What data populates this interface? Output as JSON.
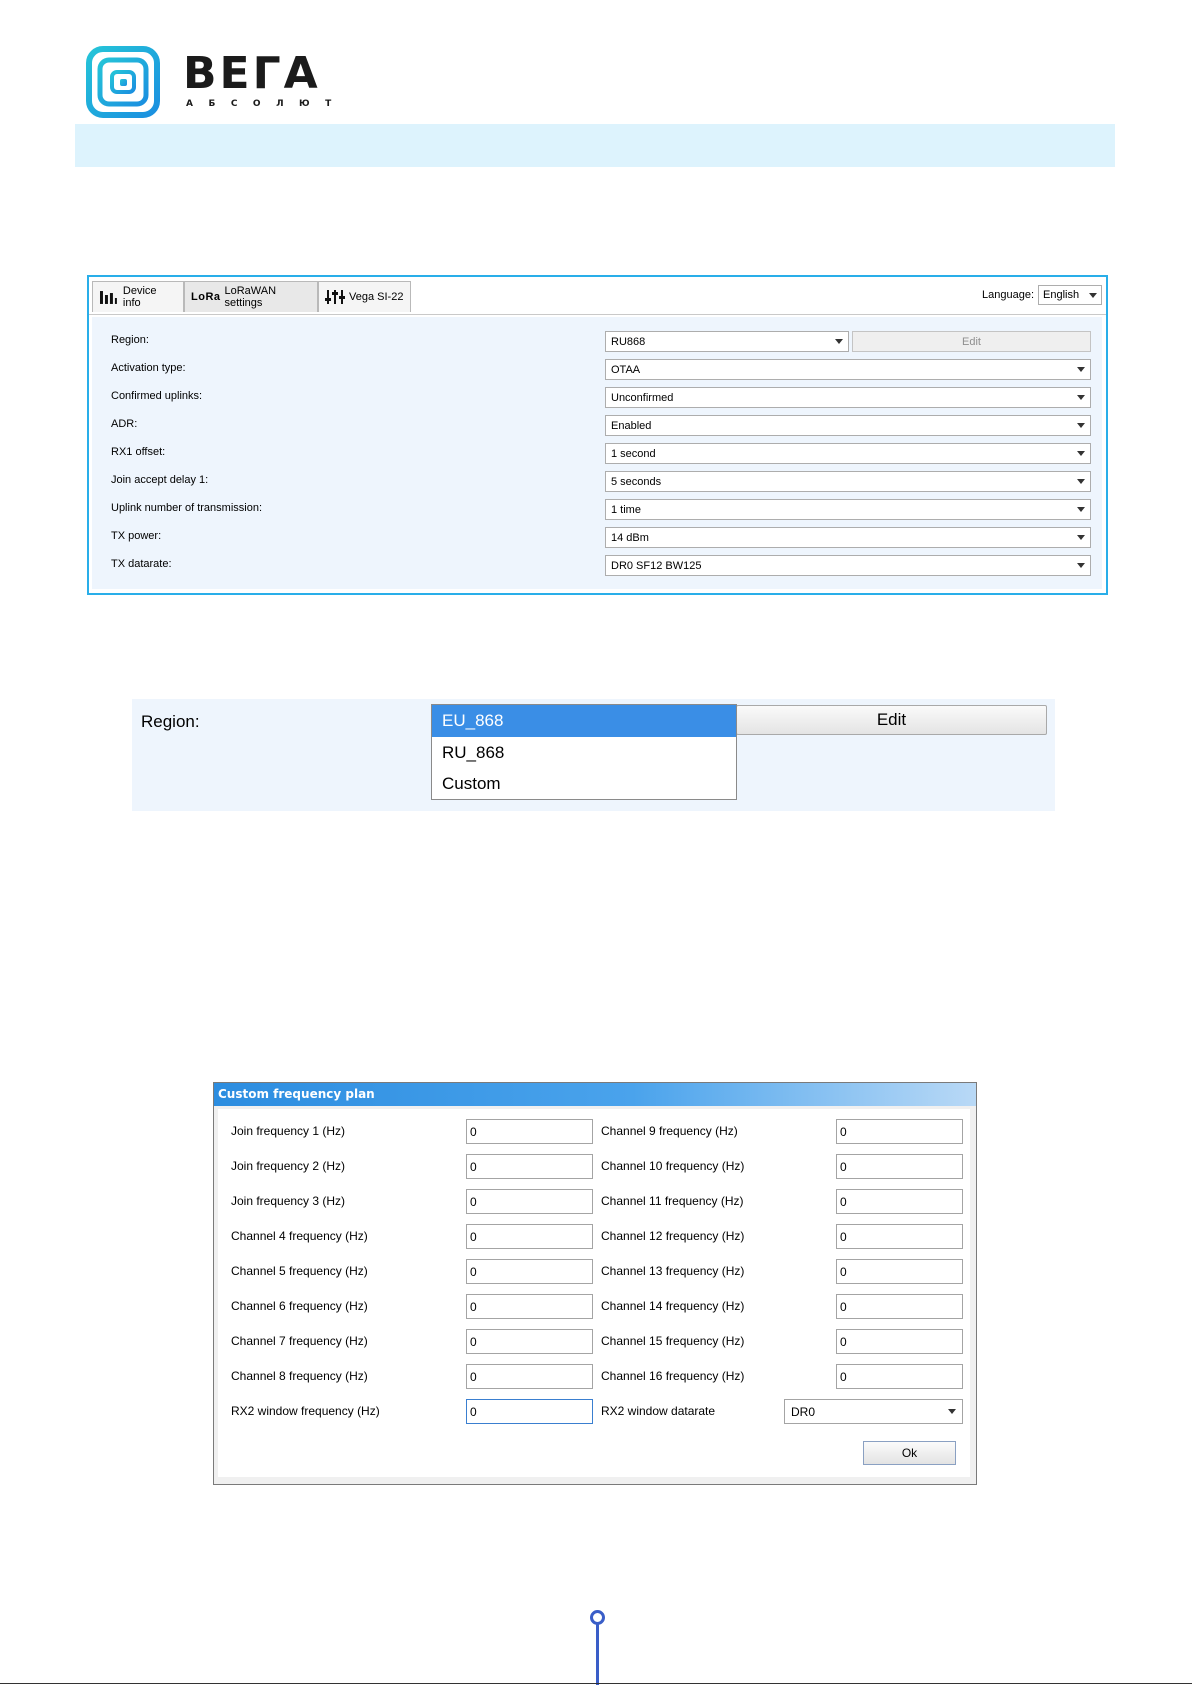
{
  "brand": {
    "name": "ВЕГА",
    "subtitle": "АБСОЛЮТ"
  },
  "app": {
    "tabs": [
      {
        "label": "Device info"
      },
      {
        "label": "LoRaWAN settings",
        "icon_text": "LoRa"
      },
      {
        "label": "Vega SI-22"
      }
    ],
    "language": {
      "label": "Language:",
      "value": "English"
    },
    "fields": [
      {
        "label": "Region:",
        "value": "RU868"
      },
      {
        "label": "Activation type:",
        "value": "OTAA"
      },
      {
        "label": "Confirmed uplinks:",
        "value": "Unconfirmed"
      },
      {
        "label": "ADR:",
        "value": "Enabled"
      },
      {
        "label": "RX1 offset:",
        "value": "1 second"
      },
      {
        "label": "Join accept delay 1:",
        "value": "5 seconds"
      },
      {
        "label": "Uplink number of transmission:",
        "value": "1 time"
      },
      {
        "label": "TX power:",
        "value": "14 dBm"
      },
      {
        "label": "TX datarate:",
        "value": "DR0 SF12 BW125"
      }
    ],
    "edit_label": "Edit"
  },
  "region_dropdown": {
    "label": "Region:",
    "edit_label": "Edit",
    "options": [
      "EU_868",
      "RU_868",
      "Custom"
    ],
    "selected": "EU_868"
  },
  "dialog": {
    "title": "Custom frequency plan",
    "left": [
      {
        "label": "Join frequency 1 (Hz)",
        "value": "0"
      },
      {
        "label": "Join frequency 2 (Hz)",
        "value": "0"
      },
      {
        "label": "Join frequency 3 (Hz)",
        "value": "0"
      },
      {
        "label": "Channel 4 frequency (Hz)",
        "value": "0"
      },
      {
        "label": "Channel 5 frequency (Hz)",
        "value": "0"
      },
      {
        "label": "Channel 6 frequency (Hz)",
        "value": "0"
      },
      {
        "label": "Channel 7 frequency (Hz)",
        "value": "0"
      },
      {
        "label": "Channel 8 frequency (Hz)",
        "value": "0"
      },
      {
        "label": "RX2 window frequency (Hz)",
        "value": "0"
      }
    ],
    "right": [
      {
        "label": "Channel 9 frequency (Hz)",
        "value": "0"
      },
      {
        "label": "Channel 10 frequency (Hz)",
        "value": "0"
      },
      {
        "label": "Channel 11 frequency (Hz)",
        "value": "0"
      },
      {
        "label": "Channel 12 frequency (Hz)",
        "value": "0"
      },
      {
        "label": "Channel 13 frequency (Hz)",
        "value": "0"
      },
      {
        "label": "Channel 14 frequency (Hz)",
        "value": "0"
      },
      {
        "label": "Channel 15 frequency (Hz)",
        "value": "0"
      },
      {
        "label": "Channel 16 frequency (Hz)",
        "value": "0"
      },
      {
        "label": "RX2 window datarate",
        "value": "DR0"
      }
    ],
    "ok_label": "Ok"
  },
  "colors": {
    "accent": "#29aee9",
    "header_bar": "#ddf3fd",
    "panel_bg": "#eef5fd",
    "selection": "#3a8ee6",
    "footer_accent": "#3a5ec8"
  },
  "icons": [
    "vega-logo-icon",
    "bar-chart-icon",
    "lora-icon",
    "sliders-icon",
    "chevron-down-icon"
  ]
}
